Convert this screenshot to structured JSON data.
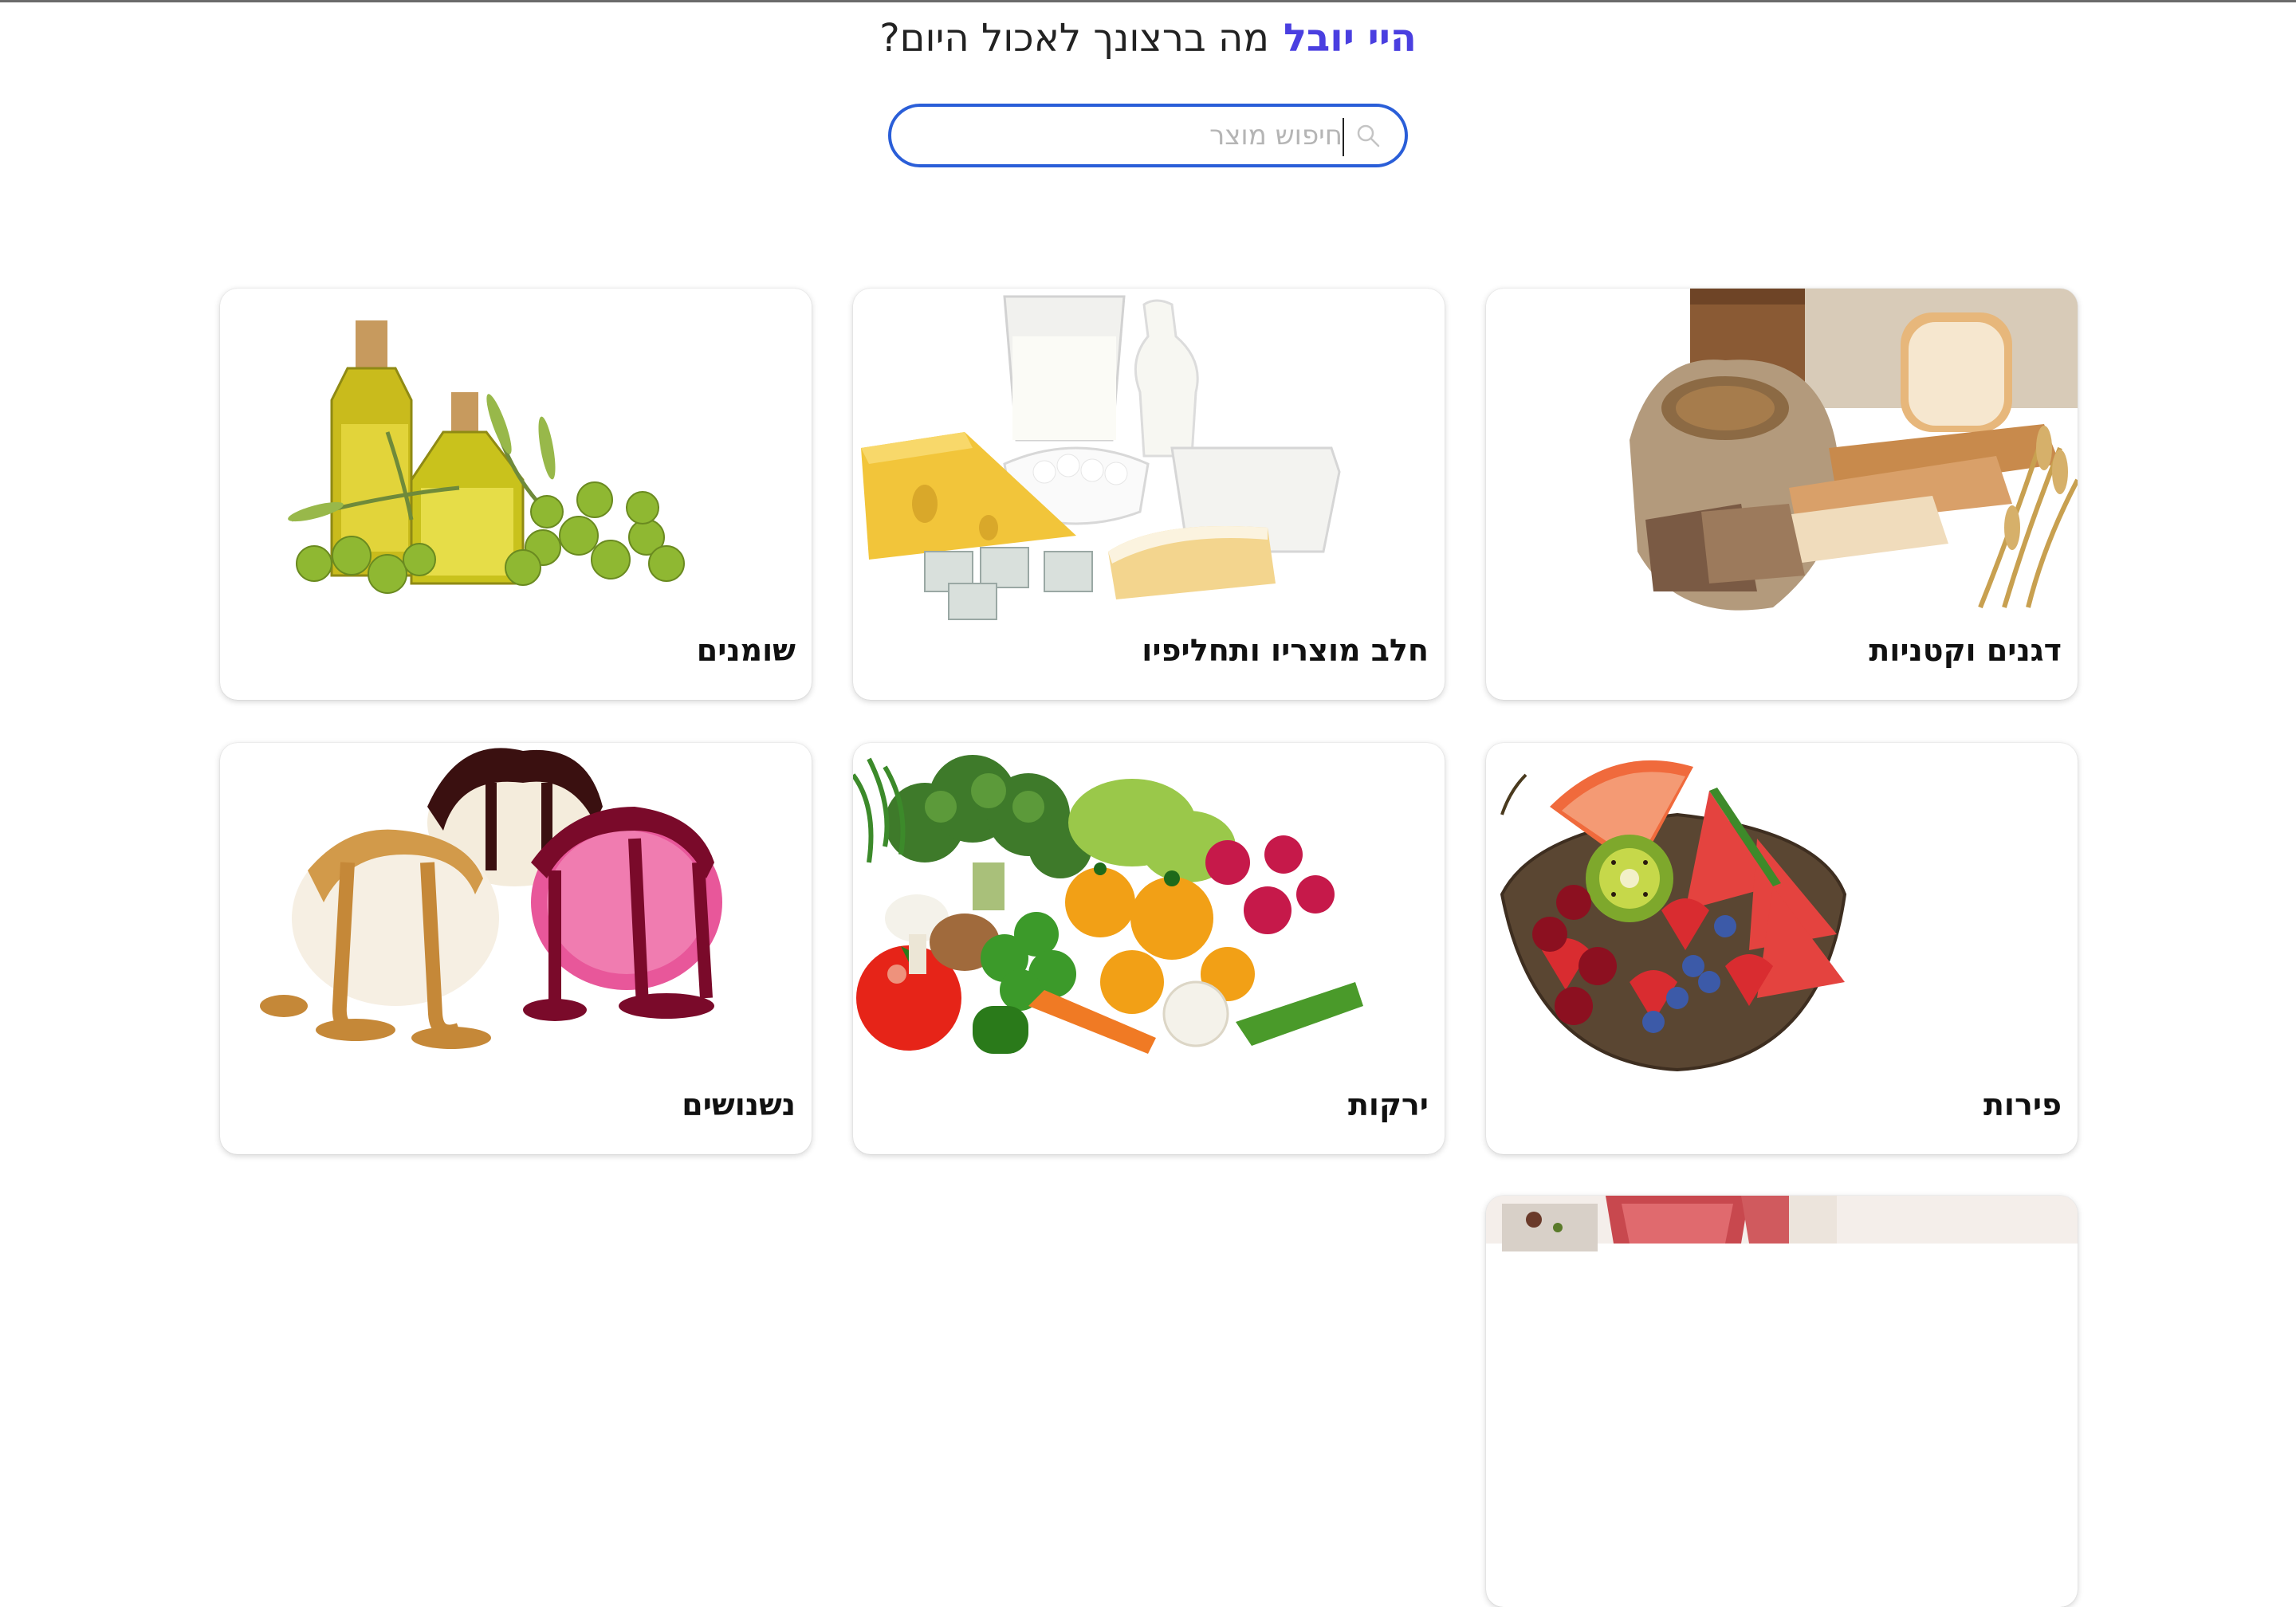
{
  "header": {
    "greeting_name": "היי יובל",
    "greeting_question": "מה ברצונך לאכול היום?"
  },
  "search": {
    "placeholder": "חיפוש מוצר",
    "value": ""
  },
  "categories": [
    {
      "label": "דגנים וקטניות",
      "icon": "grains-bread-image"
    },
    {
      "label": "חלב מוצריו ותחליפיו",
      "icon": "dairy-products-image"
    },
    {
      "label": "שומנים",
      "icon": "olive-oil-image"
    },
    {
      "label": "פירות",
      "icon": "fruit-bowl-image"
    },
    {
      "label": "ירקות",
      "icon": "vegetables-image"
    },
    {
      "label": "נשנושים",
      "icon": "ice-cream-image"
    },
    {
      "label": "",
      "icon": "meat-image"
    }
  ],
  "colors": {
    "accent": "#4a3fe0",
    "search_border": "#2a5ed8",
    "text": "#111111"
  }
}
